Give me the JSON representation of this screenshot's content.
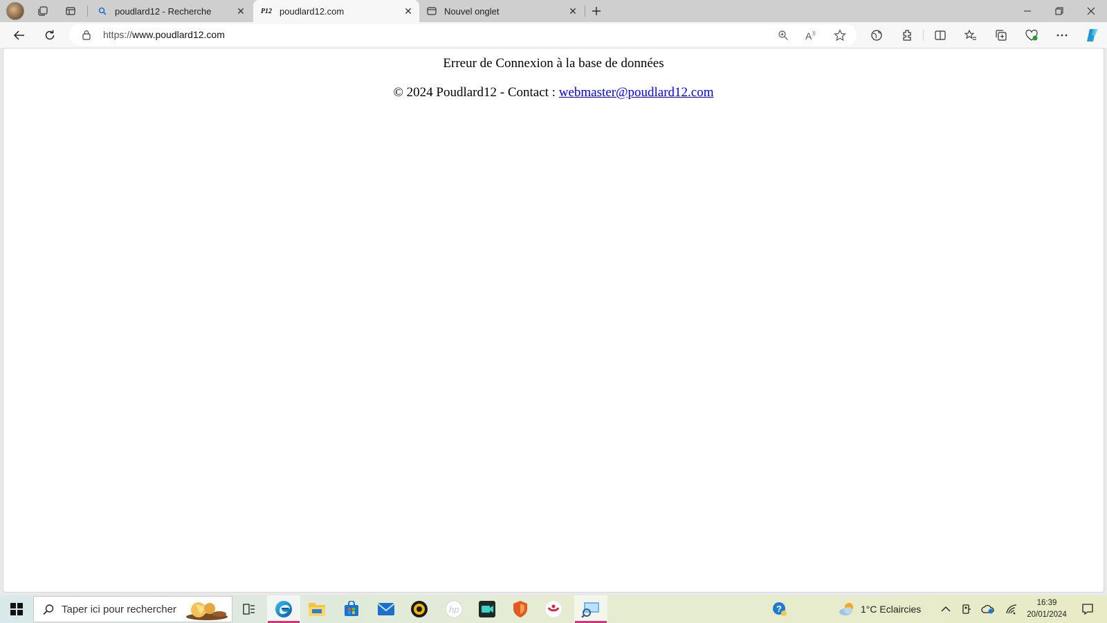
{
  "browser": {
    "tabs": [
      {
        "title": "poudlard12 - Recherche",
        "favicon": "search-icon",
        "active": false
      },
      {
        "title": "poudlard12.com",
        "favicon_text": "P12",
        "active": true
      },
      {
        "title": "Nouvel onglet",
        "favicon": "new-tab-icon",
        "active": false
      }
    ],
    "address": {
      "scheme": "https://",
      "host": "www.poudlard12.com"
    }
  },
  "page": {
    "error_message": "Erreur de Connexion à la base de données",
    "footer_prefix": "© 2024 Poudlard12 - Contact : ",
    "contact_email": "webmaster@poudlard12.com"
  },
  "taskbar": {
    "search_placeholder": "Taper ici pour rechercher",
    "weather": "1°C  Eclaircies",
    "time": "16:39",
    "date": "20/01/2024"
  },
  "colors": {
    "link": "#0000ee",
    "taskbar_indicator": "#d0357a",
    "edge_blue": "#1e7ad6"
  }
}
